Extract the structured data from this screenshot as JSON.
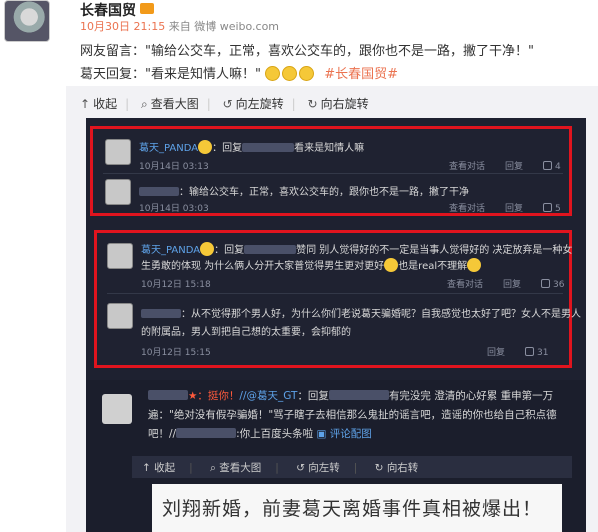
{
  "post": {
    "author": "长春国贸",
    "time": "10月30日 21:15",
    "source": "来自 微博 weibo.com",
    "line1": "网友留言：\"输给公交车，正常，喜欢公交车的，跟你也不是一路，撇了干净！\"",
    "line2": "葛天回复：\"看来是知情人嘛！\"",
    "topic": "#长春国贸#"
  },
  "toolbar": {
    "collapse": "收起",
    "view_large": "查看大图",
    "rotate_left": "向左旋转",
    "rotate_right": "向右旋转"
  },
  "screenshot": {
    "box1": {
      "c1_name": "葛天_PANDA",
      "c1_reply_prefix": "：回复",
      "c1_text": "看来是知情人嘛",
      "c1_date": "10月14日 03:13",
      "c1_view": "查看对话",
      "c1_reply": "回复",
      "c1_likes": "4",
      "c2_text": "：输给公交车，正常，喜欢公交车的，跟你也不是一路，撇了干净",
      "c2_date": "10月14日 03:03",
      "c2_view": "查看对话",
      "c2_reply": "回复",
      "c2_likes": "5"
    },
    "box2": {
      "c1_name": "葛天_PANDA",
      "c1_reply_prefix": "：回复",
      "c1_text_a": "赞同 别人觉得好的不一定是当事人觉得好的 决定放弃是一种女",
      "c1_text_b": "生勇敢的体现 为什么俩人分开大家普觉得男生更对更好",
      "c1_text_c": "也是real不理解",
      "c1_date": "10月12日 15:18",
      "c1_view": "查看对话",
      "c1_reply": "回复",
      "c1_likes": "36",
      "c2_text_a": "：从不觉得那个男人好，为什么你们老说葛天骗婚呢？自我感觉也太好了吧？女人不是男人",
      "c2_text_b": "的附属品，男人到把自己想的太重要，会抑郁的",
      "c2_date": "10月12日 15:15",
      "c2_reply": "回复",
      "c2_likes": "31"
    },
    "repost": {
      "l1_red": "★：挺你！",
      "l1_blue": "//@葛天_GT",
      "l1_rest": "：回复",
      "l1_tail": "有完没完 澄清的心好累 重申第一万",
      "l2": "遍：\"绝对没有假孕骗婚！\"骂子瞎子去相信那么鬼扯的谣言吧，造谣的你也给自己积点德",
      "l3_a": "吧！//",
      "l3_b": ":你上百度头条啦",
      "l3_link": "评论配图",
      "bar_collapse": "收起",
      "bar_view": "查看大图",
      "bar_left": "向左转",
      "bar_right": "向右转",
      "headline": "刘翔新婚，前妻葛天离婚事件真相被爆出！"
    }
  }
}
